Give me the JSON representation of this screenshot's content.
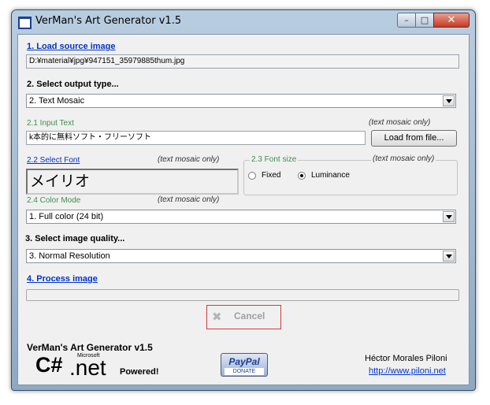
{
  "window": {
    "title": "VerMan's Art Generator v1.5",
    "controls": {
      "minimize": "–",
      "maximize": "□",
      "close": "✕"
    }
  },
  "load": {
    "link_label": "1. Load source image",
    "path": "D:¥material¥jpg¥947151_35979885thum.jpg"
  },
  "output": {
    "header": "2. Select output type...",
    "selected": "2. Text Mosaic"
  },
  "input_text": {
    "label": "2.1 Input Text",
    "note": "(text mosaic only)",
    "value": "k本的に無料ソフト・フリーソフト",
    "load_button": "Load from file..."
  },
  "font": {
    "link_label": "2.2 Select Font",
    "note": "(text mosaic only)",
    "preview": "メイリオ"
  },
  "font_size": {
    "legend": "2.3 Font size",
    "note": "(text mosaic only)",
    "options": [
      "Fixed",
      "Luminance"
    ],
    "selected": "Luminance"
  },
  "color_mode": {
    "label": "2.4 Color Mode",
    "note": "(text mosaic only)",
    "selected": "1. Full color (24 bit)"
  },
  "quality": {
    "header": "3. Select image quality...",
    "selected": "3. Normal Resolution"
  },
  "process": {
    "link_label": "4. Process image",
    "progress": 0
  },
  "cancel": {
    "label": "Cancel"
  },
  "footer": {
    "app_title": "VerMan's Art Generator v1.5",
    "csharp": "C#",
    "microsoft": "Microsoft",
    "net": ".net",
    "powered": "Powered!",
    "paypal": "PayPal",
    "donate": "DONATE",
    "author": "Héctor Morales Piloni",
    "url": "http://www.piloni.net"
  }
}
